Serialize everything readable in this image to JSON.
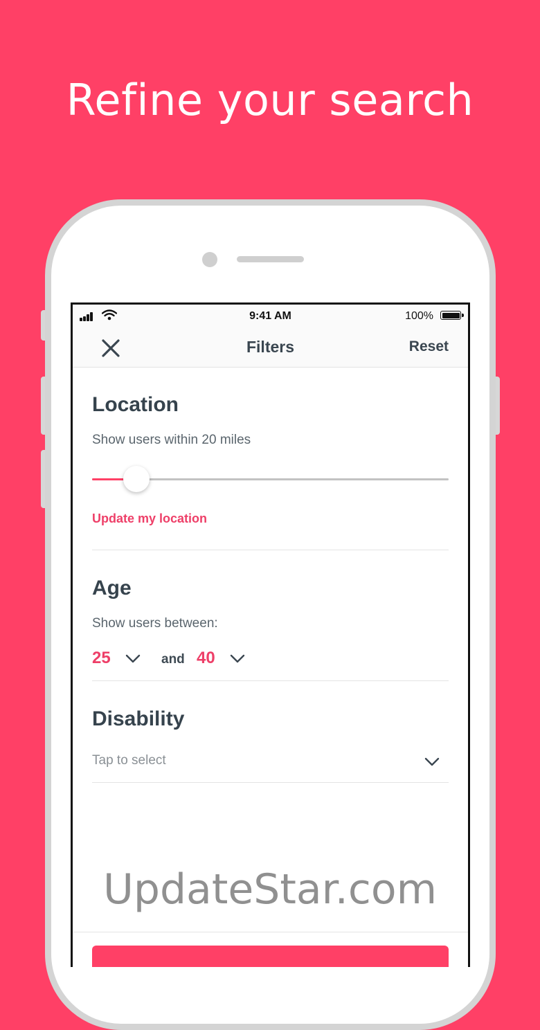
{
  "banner": {
    "headline": "Refine your search"
  },
  "colors": {
    "background": "#FF4066",
    "accent": "#EE3F68",
    "text": "#36434d"
  },
  "status_bar": {
    "time": "9:41 AM",
    "battery": "100%",
    "icons": [
      "signal-icon",
      "wifi-icon",
      "battery-icon"
    ]
  },
  "nav": {
    "title": "Filters",
    "reset_label": "Reset",
    "close_icon": "close-icon"
  },
  "location": {
    "title": "Location",
    "subtitle": "Show users within 20 miles",
    "slider_fraction": 0.125,
    "update_link": "Update my location"
  },
  "age": {
    "title": "Age",
    "subtitle": "Show users between:",
    "min": "25",
    "and_label": "and",
    "max": "40",
    "chevron_icon": "chevron-down-icon"
  },
  "disability": {
    "title": "Disability",
    "placeholder": "Tap to select",
    "chevron_icon": "chevron-down-icon"
  },
  "watermark": "UpdateStar.com"
}
